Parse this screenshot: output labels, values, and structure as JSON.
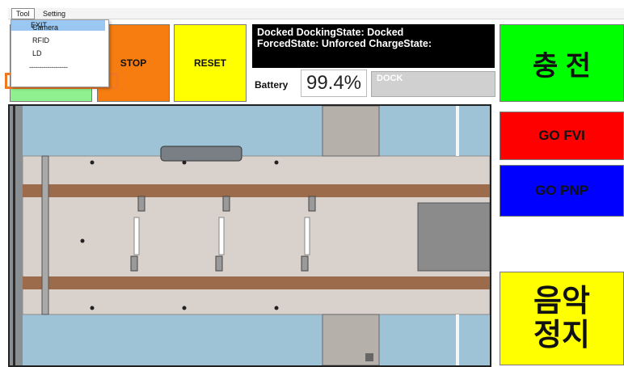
{
  "menubar": {
    "tool": "Tool",
    "setting": "Setting"
  },
  "dropdown": {
    "camera": "Camera",
    "rfid": "RFID",
    "ld": "LD",
    "separator": "-------------------",
    "exit": "EXIT"
  },
  "buttons": {
    "stop": "STOP",
    "reset": "RESET",
    "charge": "충 전",
    "go_fvi": "GO FVI",
    "go_pnp": "GO PNP",
    "music_stop": "음악\n정지"
  },
  "status": {
    "text": "Docked DockingState: Docked\nForcedState: Unforced ChargeState:"
  },
  "battery": {
    "label": "Battery",
    "value": "99.4%"
  },
  "dock": {
    "label": "DOCK"
  },
  "colors": {
    "highlight": "#f07822",
    "green_btn": "#8ef08e",
    "stop": "#f77d10",
    "reset": "#ffff00",
    "charge": "#00ff00",
    "go_fvi": "#ff0000",
    "go_pnp": "#0000ff"
  }
}
